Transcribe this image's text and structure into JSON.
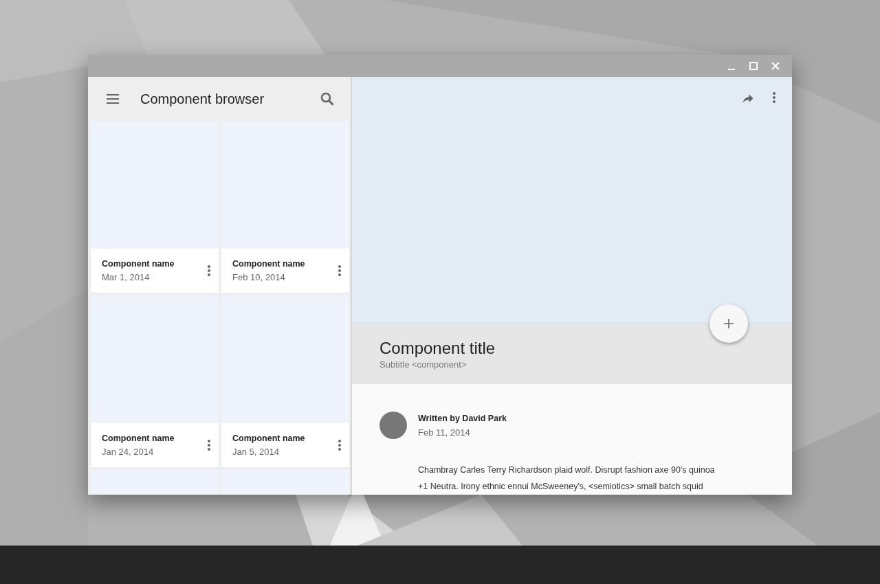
{
  "browser": {
    "title": "Component browser",
    "cards": [
      {
        "kind": "full",
        "name": "Component name",
        "date": "Mar 1, 2014"
      },
      {
        "kind": "full",
        "name": "Component name",
        "date": "Feb 10, 2014"
      },
      {
        "kind": "full",
        "name": "Component name",
        "date": "Jan 24, 2014"
      },
      {
        "kind": "full",
        "name": "Component name",
        "date": "Jan 5, 2014"
      },
      {
        "kind": "cut"
      },
      {
        "kind": "cut"
      }
    ]
  },
  "detail": {
    "title": "Component title",
    "subtitle": "Subtitle <component>",
    "author": "Written by David Park",
    "date": "Feb 11, 2014",
    "body": "Chambray Carles Terry Richardson plaid wolf. Disrupt fashion axe 90's quinoa\n+1 Neutra. Irony ethnic ennui McSweeney's, <semiotics> small batch squid"
  }
}
